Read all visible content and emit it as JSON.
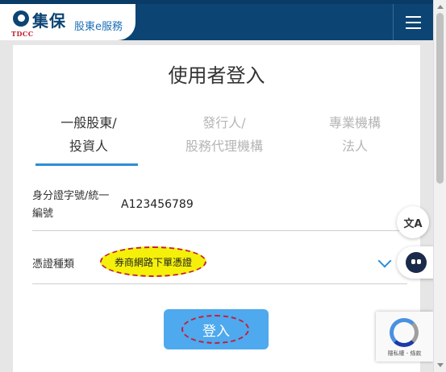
{
  "header": {
    "logo_text": "集保",
    "logo_sub": "TDCC",
    "service_name": "股東e服務",
    "menu_icon": "hamburger-menu-icon"
  },
  "login": {
    "title": "使用者登入",
    "tabs": [
      {
        "line1": "一般股東/",
        "line2": "投資人",
        "active": true
      },
      {
        "line1": "發行人/",
        "line2": "股務代理機構",
        "active": false
      },
      {
        "line1": "專業機構",
        "line2": "法人",
        "active": false
      }
    ],
    "id_label": "身分證字號/統一編號",
    "id_value": "A123456789",
    "cert_label": "憑證種類",
    "cert_value": "券商網路下單憑證",
    "submit_label": "登入"
  },
  "widgets": {
    "translate_label": "文A",
    "recaptcha_text": "隱私權 - 條款"
  },
  "colors": {
    "header_bg": "#0c4474",
    "accent": "#2d8fd6",
    "button_bg": "#4ea9ee",
    "highlight": "#f4f00a",
    "annotation": "#c0203a"
  }
}
